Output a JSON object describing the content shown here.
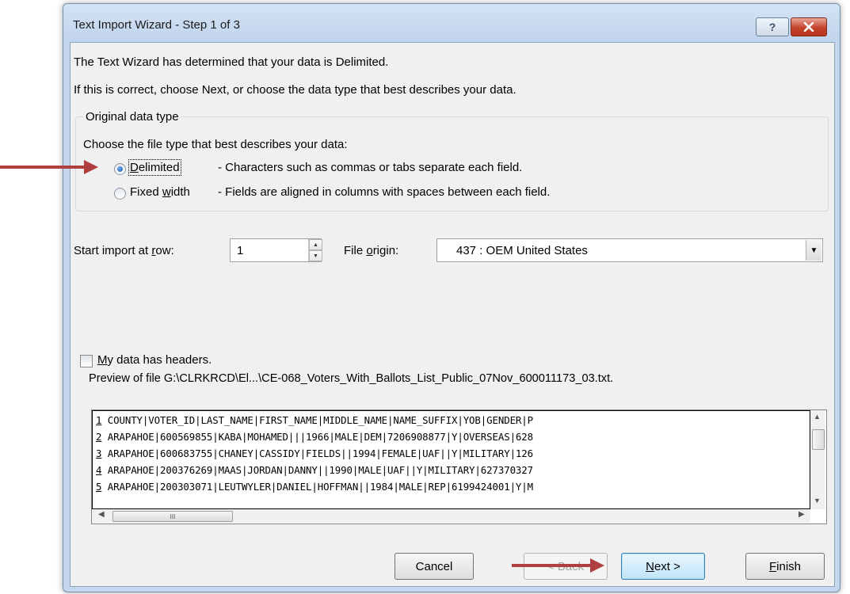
{
  "window": {
    "title": "Text Import Wizard - Step 1 of 3",
    "help_glyph": "?",
    "close_glyph": "✕"
  },
  "intro": {
    "line1": "The Text Wizard has determined that your data is Delimited.",
    "line2": "If this is correct, choose Next, or choose the data type that best describes your data."
  },
  "data_type": {
    "group_label": "Original data type",
    "prompt": "Choose the file type that best describes your data:",
    "options": [
      {
        "label_pre": "",
        "label_key": "D",
        "label_post": "elimited",
        "description": "- Characters such as commas or tabs separate each field.",
        "selected": true
      },
      {
        "label_pre": "Fixed ",
        "label_key": "w",
        "label_post": "idth",
        "description": "- Fields are aligned in columns with spaces between each field.",
        "selected": false
      }
    ]
  },
  "start_row": {
    "label_pre": "Start import at ",
    "label_key": "r",
    "label_post": "ow:",
    "value": "1"
  },
  "file_origin": {
    "label_pre": "File ",
    "label_key": "o",
    "label_post": "rigin:",
    "value": "437 : OEM United States"
  },
  "headers_checkbox": {
    "label_key": "M",
    "label_post": "y data has headers.",
    "checked": false
  },
  "preview": {
    "label": "Preview of file G:\\CLRKRCD\\El...\\CE-068_Voters_With_Ballots_List_Public_07Nov_600011173_03.txt.",
    "rows": [
      {
        "num": "1",
        "text": "COUNTY|VOTER_ID|LAST_NAME|FIRST_NAME|MIDDLE_NAME|NAME_SUFFIX|YOB|GENDER|P"
      },
      {
        "num": "2",
        "text": "ARAPAHOE|600569855|KABA|MOHAMED|||1966|MALE|DEM|7206908877|Y|OVERSEAS|628"
      },
      {
        "num": "3",
        "text": "ARAPAHOE|600683755|CHANEY|CASSIDY|FIELDS||1994|FEMALE|UAF||Y|MILITARY|126"
      },
      {
        "num": "4",
        "text": "ARAPAHOE|200376269|MAAS|JORDAN|DANNY||1990|MALE|UAF||Y|MILITARY|627370327"
      },
      {
        "num": "5",
        "text": "ARAPAHOE|200303071|LEUTWYLER|DANIEL|HOFFMAN||1984|MALE|REP|6199424001|Y|M"
      }
    ]
  },
  "buttons": {
    "cancel": "Cancel",
    "back": "< Back",
    "next_key": "N",
    "next_post": "ext >",
    "finish_key": "F",
    "finish_post": "inish"
  },
  "icons": {
    "spin_up": "▲",
    "spin_down": "▼",
    "dropdown": "▼",
    "scroll_up": "▲",
    "scroll_down": "▼",
    "scroll_left": "◀",
    "scroll_right": "▶",
    "grip": "III"
  },
  "annotation_color": "#b04040"
}
